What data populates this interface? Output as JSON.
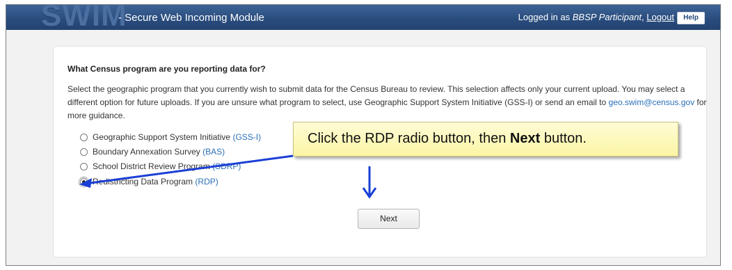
{
  "header": {
    "logo_text": "SWIM",
    "app_title": "- Secure Web Incoming Module",
    "logged_in_prefix": "Logged in as",
    "user_role": "BBSP Participant",
    "user_separator": ",",
    "logout_label": "Logout",
    "help_label": "Help"
  },
  "main": {
    "question": "What Census program are you reporting data for?",
    "description_part1": "Select the geographic program that you currently wish to submit data for the Census Bureau to review. This selection affects only your current upload. You may select a different option for future uploads. If you are unsure what program to select, use Geographic Support System Initiative (GSS-I) or send an email to ",
    "email": "geo.swim@census.gov",
    "description_part2": " for more guidance.",
    "options": [
      {
        "label": "Geographic Support System Initiative",
        "code": "(GSS-I)",
        "selected": false
      },
      {
        "label": "Boundary Annexation Survey",
        "code": "(BAS)",
        "selected": false
      },
      {
        "label": "School District Review Program",
        "code": "(SDRP)",
        "selected": false
      },
      {
        "label": "Redistricting Data Program",
        "code": "(RDP)",
        "selected": true
      }
    ],
    "next_label": "Next"
  },
  "callout": {
    "text_before": "Click the RDP radio button, then ",
    "bold": "Next",
    "text_after": " button."
  },
  "colors": {
    "header_bg": "#2a4d7e",
    "link": "#2a6fb8",
    "callout_bg": "#fbf5a4",
    "arrow": "#1a3fd6"
  }
}
